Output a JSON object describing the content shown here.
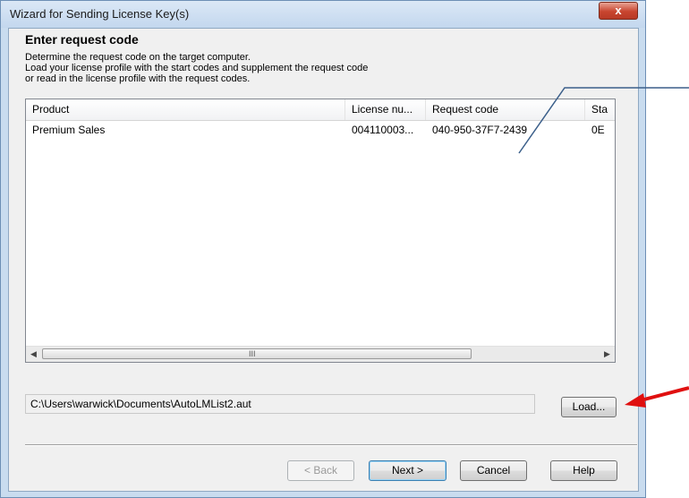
{
  "window": {
    "title": "Wizard for Sending License Key(s)",
    "close_glyph": "x"
  },
  "page": {
    "heading": "Enter request code",
    "description": [
      "Determine the request code on the target computer.",
      "Load your license profile with the start codes and supplement the request code",
      "or read in the license profile with the request codes."
    ]
  },
  "table": {
    "columns": [
      "Product",
      "License nu...",
      "Request code",
      "Sta"
    ],
    "rows": [
      [
        "Premium Sales",
        "004110003...",
        "040-950-37F7-2439",
        "0E"
      ]
    ]
  },
  "scrollbar": {
    "left_arrow": "◀",
    "right_arrow": "▶",
    "grip": "III"
  },
  "profile_path": "C:\\Users\\warwick\\Documents\\AutoLMList2.aut",
  "buttons": {
    "load": "Load...",
    "back": "< Back",
    "next": "Next >",
    "cancel": "Cancel",
    "help": "Help"
  },
  "annotation_colors": {
    "callout_line": "#3b5f8a",
    "arrow": "#e01010"
  }
}
